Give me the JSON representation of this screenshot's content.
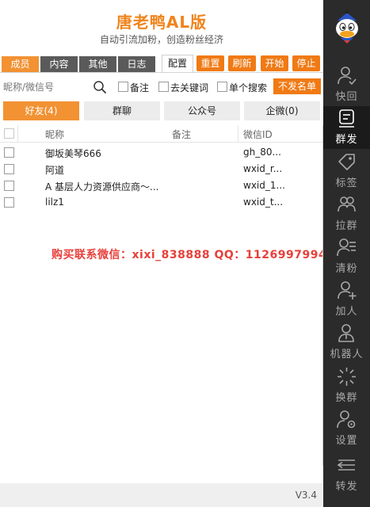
{
  "app": {
    "title": "唐老鸭AL版",
    "subtitle": "自动引流加粉，创造粉丝经济",
    "version": "V3.4"
  },
  "tabs": [
    {
      "label": "成员",
      "active": true
    },
    {
      "label": "内容",
      "active": false
    },
    {
      "label": "其他",
      "active": false
    },
    {
      "label": "日志",
      "active": false
    }
  ],
  "config_tab": "配置",
  "actions": {
    "reset": "重置",
    "refresh": "刷新",
    "start": "开始",
    "stop": "停止"
  },
  "search": {
    "placeholder": "昵称/微信号",
    "opt_remark": "备注",
    "opt_keyword": "去关键词",
    "opt_single": "单个搜索",
    "blacklist_button": "不发名单"
  },
  "segments": [
    {
      "label": "好友(4)",
      "active": true
    },
    {
      "label": "群聊",
      "active": false
    },
    {
      "label": "公众号",
      "active": false
    },
    {
      "label": "企微(0)",
      "active": false
    }
  ],
  "table": {
    "columns": [
      "昵称",
      "备注",
      "微信ID"
    ],
    "rows": [
      {
        "nickname": "御坂美琴666",
        "remark": "",
        "wxid": "gh_80..."
      },
      {
        "nickname": "阿道",
        "remark": "",
        "wxid": "wxid_r..."
      },
      {
        "nickname": "A 基层人力资源供应商～...",
        "remark": "",
        "wxid": "wxid_1..."
      },
      {
        "nickname": "lilz1",
        "remark": "",
        "wxid": "wxid_t..."
      }
    ]
  },
  "watermark": "购买联系微信：xixi_838888    QQ：1126997994",
  "sidebar": {
    "items": [
      {
        "label": "快回",
        "icon": "quick-reply-icon",
        "active": false
      },
      {
        "label": "群发",
        "icon": "mass-send-icon",
        "active": true
      },
      {
        "label": "标签",
        "icon": "tag-icon",
        "active": false
      },
      {
        "label": "拉群",
        "icon": "pull-group-icon",
        "active": false
      },
      {
        "label": "清粉",
        "icon": "clean-fans-icon",
        "active": false
      },
      {
        "label": "加人",
        "icon": "add-person-icon",
        "active": false
      },
      {
        "label": "机器人",
        "icon": "robot-icon",
        "active": false
      },
      {
        "label": "换群",
        "icon": "switch-group-icon",
        "active": false
      },
      {
        "label": "设置",
        "icon": "settings-icon",
        "active": false
      },
      {
        "label": "转发",
        "icon": "forward-icon",
        "active": false
      }
    ]
  },
  "colors": {
    "accent": "#f29233",
    "button": "#f07a14",
    "title": "#f0841c",
    "watermark": "#e8403b",
    "sidebar_bg": "#2b2b2b"
  }
}
